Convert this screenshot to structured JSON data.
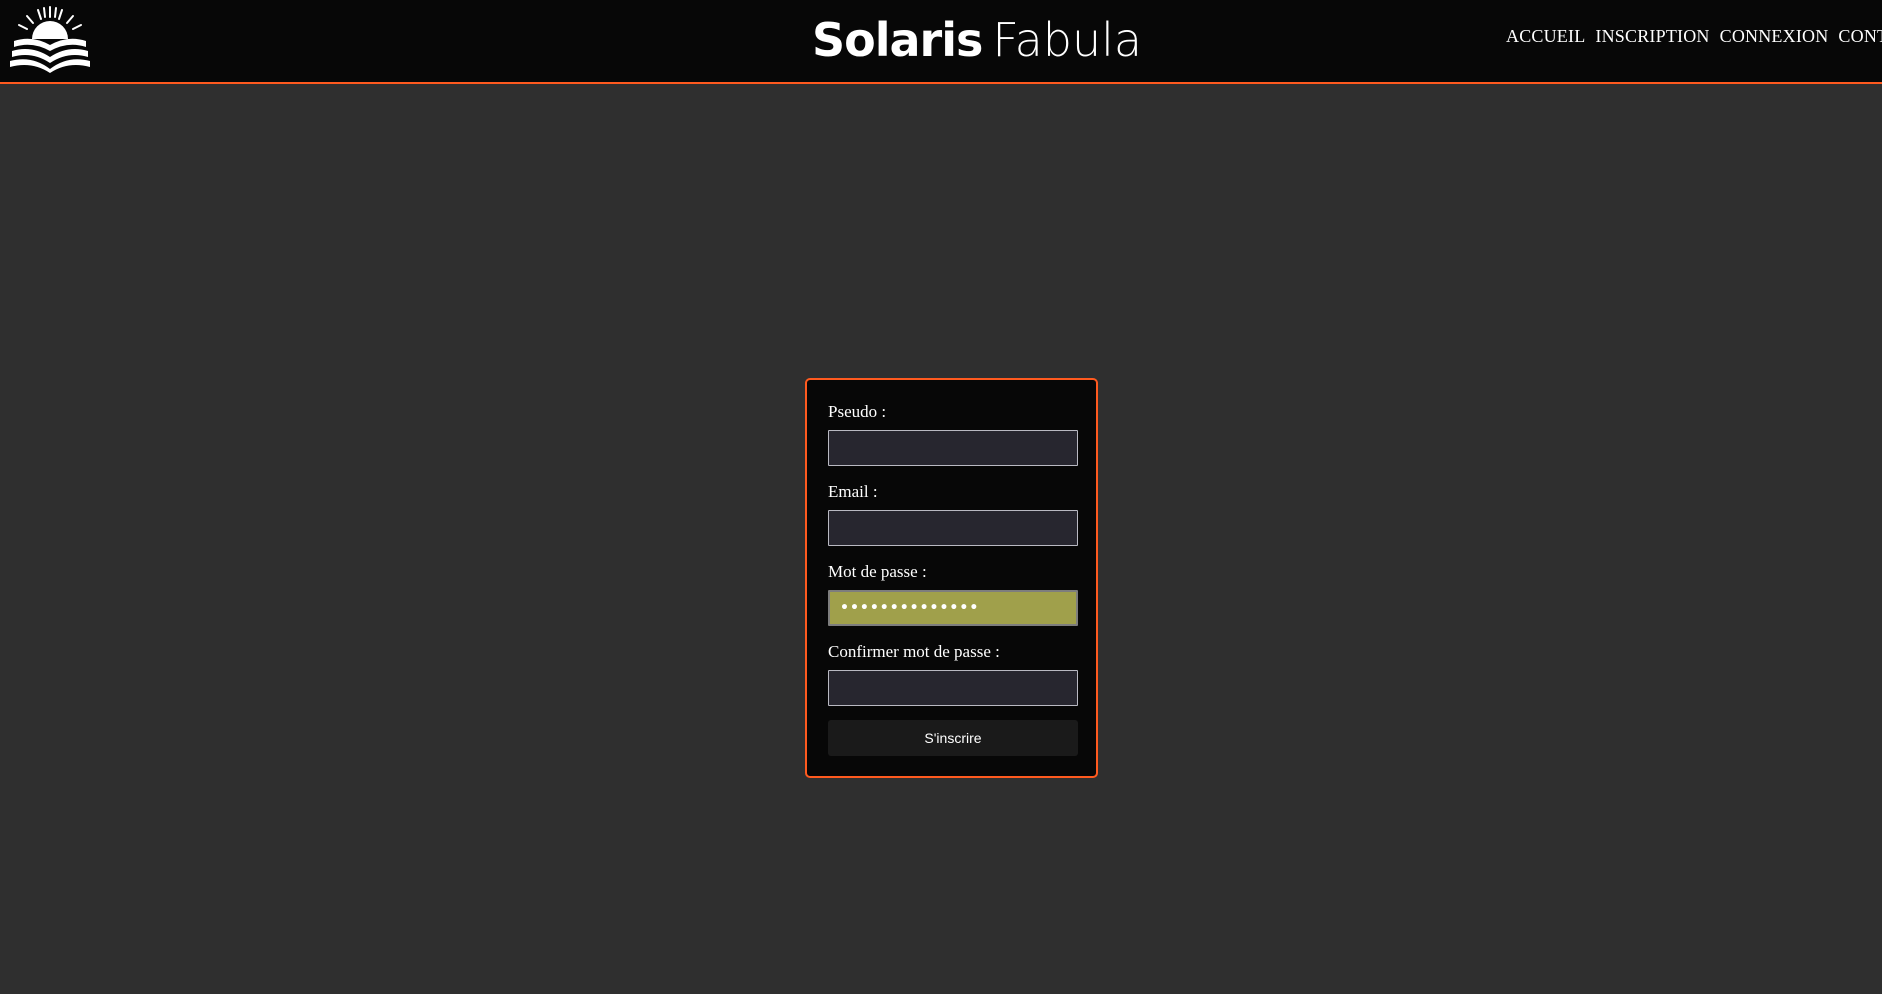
{
  "header": {
    "brand_bold": "Solaris",
    "brand_light": "Fabula",
    "logo_icon": "sun-book-logo-icon",
    "nav": [
      {
        "label": "ACCUEIL"
      },
      {
        "label": "INSCRIPTION"
      },
      {
        "label": "CONNEXION"
      },
      {
        "label": "CONTACT"
      }
    ]
  },
  "form": {
    "pseudo_label": "Pseudo :",
    "pseudo_value": "",
    "email_label": "Email :",
    "email_value": "",
    "password_label": "Mot de passe :",
    "password_value": "••••••••••••••",
    "confirm_label": "Confirmer mot de passe :",
    "confirm_value": "",
    "submit_label": "S'inscrire"
  },
  "colors": {
    "accent": "#ff5a1f",
    "page_bg": "#2f2f2f",
    "bar_bg": "#070707",
    "autofill": "#a0a04b"
  }
}
